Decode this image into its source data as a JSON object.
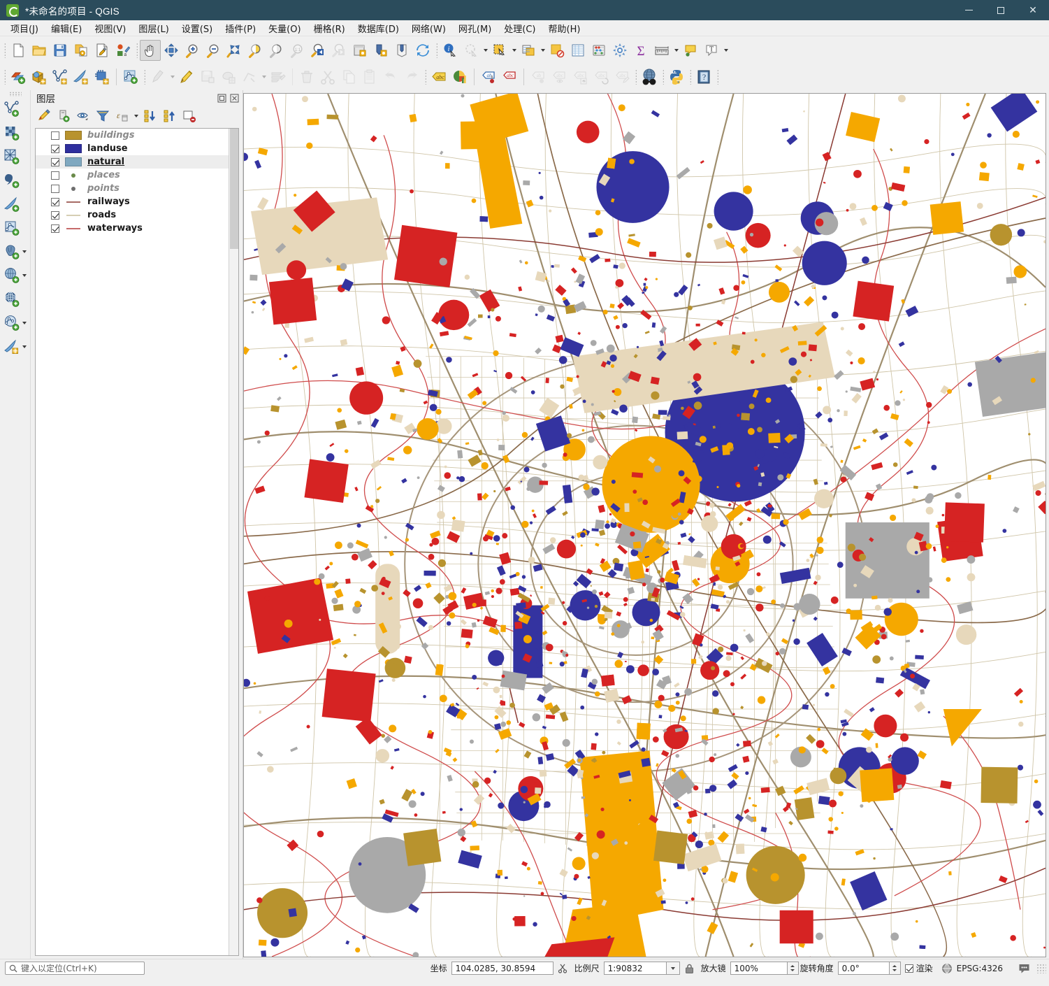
{
  "window": {
    "title": "*未命名的项目 - QGIS",
    "app_icon": "qgis-logo",
    "controls": {
      "minimize": "minimize-icon",
      "maximize": "maximize-icon",
      "close": "close-icon"
    },
    "titlebar_color": "#2b4c5c"
  },
  "menubar": {
    "items": [
      {
        "label": "项目(J)"
      },
      {
        "label": "编辑(E)"
      },
      {
        "label": "视图(V)"
      },
      {
        "label": "图层(L)"
      },
      {
        "label": "设置(S)"
      },
      {
        "label": "插件(P)"
      },
      {
        "label": "矢量(O)"
      },
      {
        "label": "栅格(R)"
      },
      {
        "label": "数据库(D)"
      },
      {
        "label": "网络(W)"
      },
      {
        "label": "网孔(M)"
      },
      {
        "label": "处理(C)"
      },
      {
        "label": "帮助(H)"
      }
    ]
  },
  "toolbar_main": {
    "icons": [
      "new-project-icon",
      "open-project-icon",
      "save-project-icon",
      "save-project-as-icon",
      "project-properties-icon",
      "style-manager-icon",
      "pan-map-icon",
      "pan-to-selection-icon",
      "zoom-in-icon",
      "zoom-out-icon",
      "zoom-full-icon",
      "zoom-to-selection-icon",
      "zoom-to-layer-icon",
      "zoom-native-icon",
      "zoom-last-icon",
      "zoom-next-icon",
      "new-map-view-icon",
      "new-3d-map-view-icon",
      "new-print-layout-icon",
      "refresh-icon",
      "identify-features-icon",
      "run-feature-action-icon",
      "select-features-icon",
      "deselect-features-icon",
      "open-field-calculator-icon",
      "open-attribute-table-icon",
      "statistical-summary-icon",
      "processing-toolbox-icon",
      "show-summary-icon",
      "measure-line-icon",
      "map-tips-icon",
      "new-text-annotation-icon"
    ]
  },
  "toolbar_digitizing": {
    "icons": [
      "new-shapefile-layer-icon",
      "new-geopackage-layer-icon",
      "new-spatialite-layer-icon",
      "new-virtual-layer-icon",
      "new-memory-layer-icon",
      "new-mesh-layer-icon",
      "current-edits-icon",
      "toggle-editing-icon",
      "save-layer-edits-icon",
      "add-polygon-feature-icon",
      "vertex-tool-icon",
      "modify-attributes-icon",
      "delete-selected-icon",
      "cut-features-icon",
      "copy-features-icon",
      "paste-features-icon",
      "undo-icon",
      "redo-icon",
      "label-layer-icon",
      "diagram-layer-icon",
      "highlight-pinned-labels-icon",
      "highlight-unplaced-labels-icon",
      "pin-labels-icon",
      "show-hide-labels-icon",
      "move-label-icon",
      "rotate-label-icon",
      "change-label-icon",
      "osm-download-icon",
      "python-console-icon",
      "help-contents-icon"
    ]
  },
  "toolbar_data_source": {
    "icons": [
      "add-vector-layer-icon",
      "add-raster-layer-icon",
      "add-mesh-layer-icon",
      "add-delimited-text-layer-icon",
      "add-vector-tile-layer-icon",
      "add-spatialite-layer-icon",
      "add-postgis-layer-icon",
      "add-mssql-layer-icon",
      "add-wms-layer-icon",
      "add-wfs-layer-icon",
      "add-arcgis-server-layer-icon"
    ]
  },
  "layers_panel": {
    "title": "图层",
    "header_buttons": [
      "float-panel-icon",
      "close-panel-icon"
    ],
    "toolbar_icons": [
      "open-layer-styling-panel-icon",
      "add-group-icon",
      "manage-map-themes-icon",
      "filter-legend-icon",
      "filter-legend-expression-icon",
      "expand-all-icon",
      "collapse-all-icon",
      "remove-layer-icon"
    ],
    "layers": [
      {
        "name": "buildings",
        "visible": false,
        "symbol": "fill",
        "color": "#b8932e",
        "selected": false,
        "underline": false
      },
      {
        "name": "landuse",
        "visible": true,
        "symbol": "fill",
        "color": "#2f2f9e",
        "selected": false,
        "underline": false
      },
      {
        "name": "natural",
        "visible": true,
        "symbol": "fill",
        "color": "#7fa8c0",
        "selected": true,
        "underline": true
      },
      {
        "name": "places",
        "visible": false,
        "symbol": "point",
        "color": "#6a8a4a",
        "selected": false,
        "underline": false
      },
      {
        "name": "points",
        "visible": false,
        "symbol": "point",
        "color": "#6e6e6e",
        "selected": false,
        "underline": false
      },
      {
        "name": "railways",
        "visible": true,
        "symbol": "line",
        "color": "#8a3a32",
        "selected": false,
        "underline": false
      },
      {
        "name": "roads",
        "visible": true,
        "symbol": "line",
        "color": "#c9bd9a",
        "selected": false,
        "underline": false
      },
      {
        "name": "waterways",
        "visible": true,
        "symbol": "line",
        "color": "#b33a3a",
        "selected": false,
        "underline": false
      }
    ]
  },
  "map": {
    "background": "#ffffff",
    "palette": {
      "landuse_blue": "#3433a0",
      "red": "#d62323",
      "amber": "#f5a800",
      "gray": "#a9a9a9",
      "beige": "#e7d8bb",
      "gold": "#b8932e",
      "road": "#c6bb9c",
      "road_major": "#8a6a4a",
      "waterway": "#cf4b4b"
    }
  },
  "statusbar": {
    "locator_icon": "search-icon",
    "locator_placeholder": "键入以定位(Ctrl+K)",
    "coordinate_label": "坐标",
    "coordinate_value": "104.0285, 30.8594",
    "coordinate_toggle_icon": "toggle-extents-icon",
    "scale_label": "比例尺",
    "scale_value": "1:90832",
    "lock_icon": "lock-scale-icon",
    "magnifier_label": "放大镜",
    "magnifier_value": "100%",
    "rotation_label": "旋转角度",
    "rotation_value": "0.0°",
    "render_label": "渲染",
    "render_checked": true,
    "crs_icon": "crs-globe-icon",
    "crs_value": "EPSG:4326",
    "messages_icon": "messages-bubble-icon"
  }
}
